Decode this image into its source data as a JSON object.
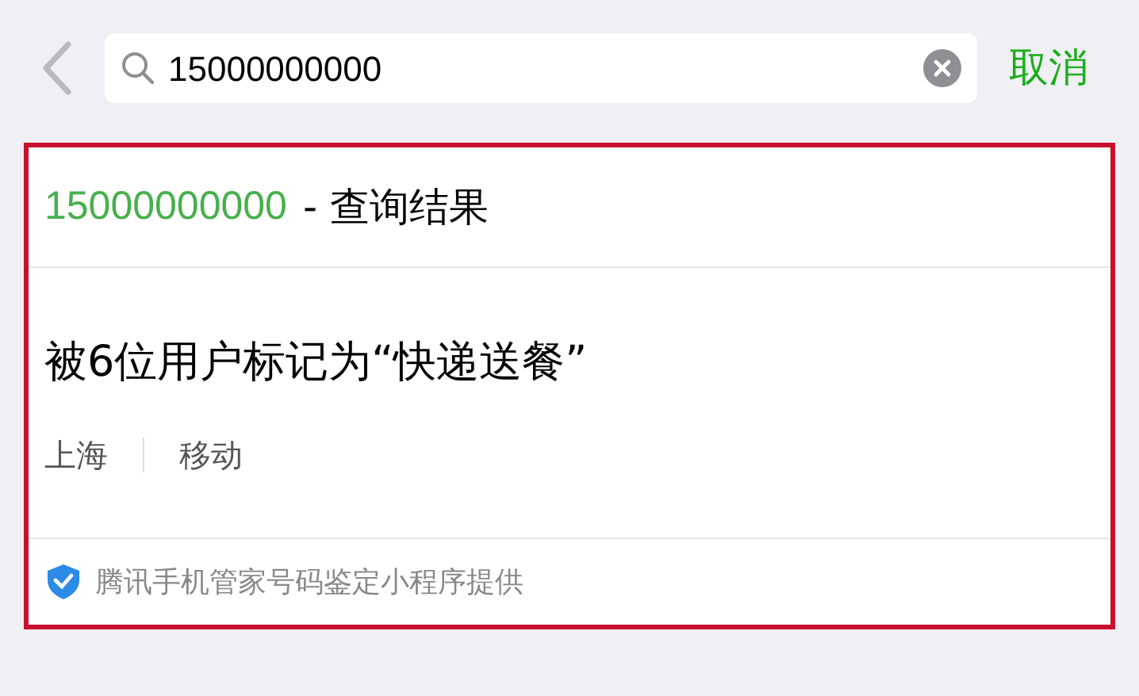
{
  "search_bar": {
    "value": "15000000000",
    "cancel": "取消"
  },
  "result": {
    "number": "15000000000",
    "title_suffix": "- 查询结果",
    "label": "被6位用户标记为“快递送餐”",
    "details": [
      "上海",
      "移动"
    ],
    "source": "腾讯手机管家号码鉴定小程序提供"
  }
}
